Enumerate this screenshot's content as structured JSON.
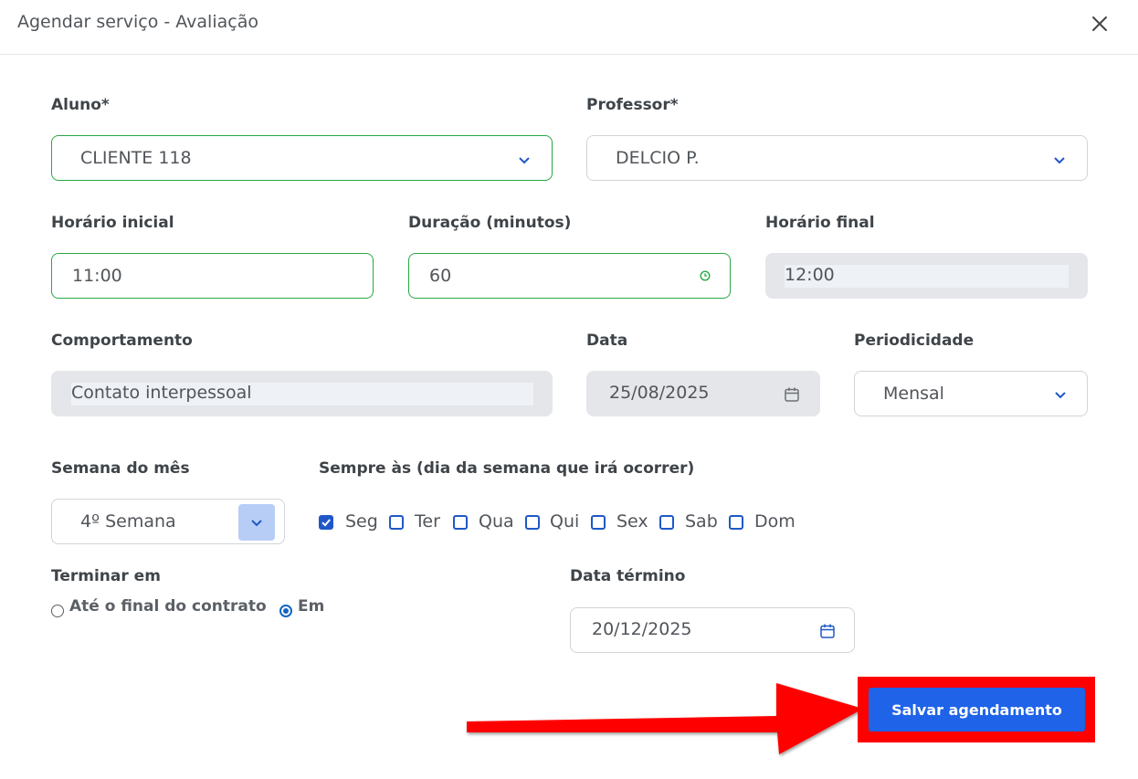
{
  "header": {
    "title": "Agendar serviço - Avaliação",
    "close_icon": "close-icon"
  },
  "form": {
    "aluno": {
      "label": "Aluno*",
      "value": "CLIENTE 118"
    },
    "professor": {
      "label": "Professor*",
      "value": "DELCIO P."
    },
    "horario_inicial": {
      "label": "Horário inicial",
      "value": "11:00"
    },
    "duracao": {
      "label": "Duração (minutos)",
      "value": "60"
    },
    "horario_final": {
      "label": "Horário final",
      "value": "12:00"
    },
    "comportamento": {
      "label": "Comportamento",
      "value": "Contato interpessoal"
    },
    "data": {
      "label": "Data",
      "value": "25/08/2025"
    },
    "periodicidade": {
      "label": "Periodicidade",
      "value": "Mensal"
    },
    "semana_do_mes": {
      "label": "Semana do mês",
      "value": "4º Semana"
    },
    "sempre_as": {
      "label": "Sempre às (dia da semana que irá ocorrer)",
      "days": [
        {
          "label": "Seg",
          "checked": true
        },
        {
          "label": "Ter",
          "checked": false
        },
        {
          "label": "Qua",
          "checked": false
        },
        {
          "label": "Qui",
          "checked": false
        },
        {
          "label": "Sex",
          "checked": false
        },
        {
          "label": "Sab",
          "checked": false
        },
        {
          "label": "Dom",
          "checked": false
        }
      ]
    },
    "terminar_em": {
      "label": "Terminar em",
      "options": [
        {
          "label": "Até o final do contrato",
          "selected": false
        },
        {
          "label": "Em",
          "selected": true
        }
      ]
    },
    "data_termino": {
      "label": "Data término",
      "value": "20/12/2025"
    }
  },
  "actions": {
    "save_label": "Salvar agendamento"
  },
  "colors": {
    "accent": "#1f63e8",
    "valid": "#28a745",
    "highlight": "#ff0000"
  }
}
